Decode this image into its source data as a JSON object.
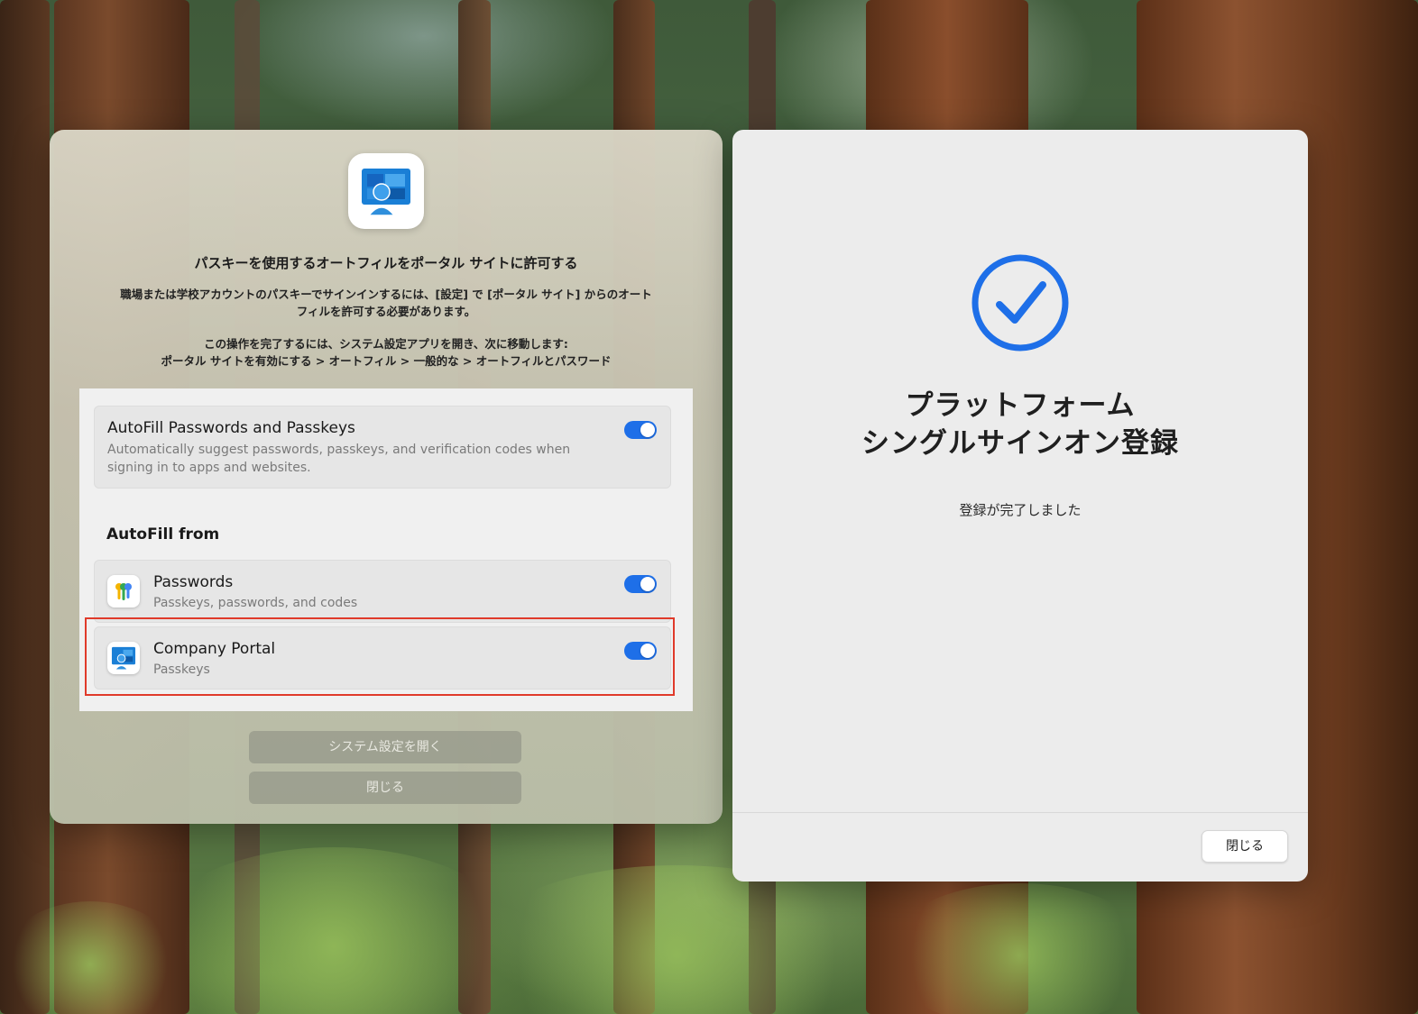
{
  "left_dialog": {
    "title": "パスキーを使用するオートフィルをポータル サイトに許可する",
    "description_line1": "職場または学校アカウントのパスキーでサインインするには、[設定] で [ポータル サイト] からのオート",
    "description_line2": "フィルを許可する必要があります。",
    "instruction_line1": "この操作を完了するには、システム設定アプリを開き、次に移動します:",
    "instruction_line2": "ポータル サイトを有効にする > オートフィル > 一般的な > オートフィルとパスワード",
    "settings": {
      "autofill_title": "AutoFill Passwords and Passkeys",
      "autofill_desc_line1": "Automatically suggest passwords, passkeys, and verification codes when",
      "autofill_desc_line2": "signing in to apps and websites.",
      "autofill_enabled": true,
      "section_label": "AutoFill from",
      "providers": [
        {
          "name": "Passwords",
          "detail": "Passkeys, passwords, and codes",
          "icon": "passwords-app-icon",
          "enabled": true
        },
        {
          "name": "Company Portal",
          "detail": "Passkeys",
          "icon": "company-portal-icon",
          "enabled": true
        }
      ]
    },
    "highlight_color": "#e03a2a",
    "open_settings_button": "システム設定を開く",
    "close_button": "閉じる"
  },
  "right_dialog": {
    "title_line1": "プラットフォーム",
    "title_line2": "シングルサインオン登録",
    "status": "登録が完了しました",
    "close_button": "閉じる",
    "check_icon": "checkmark-circle-icon",
    "accent_color": "#1e6fe8"
  }
}
